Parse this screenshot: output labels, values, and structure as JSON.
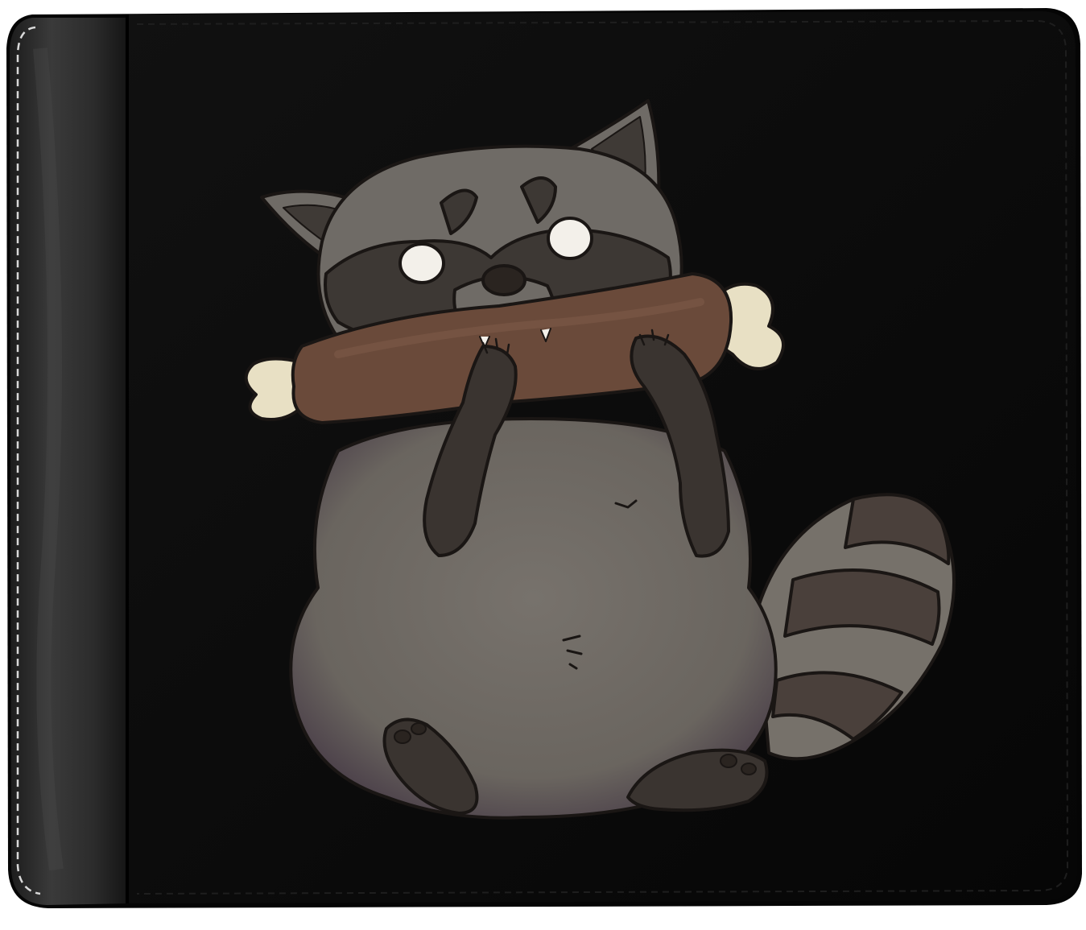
{
  "scene": {
    "subject": "wallet-product-photo",
    "colors": {
      "background": "#ffffff",
      "wallet_front": "#0b0b0b",
      "wallet_spine": "#2a2a2a",
      "stitching": "#d9d9d9",
      "fur_main": "#6f6b66",
      "fur_shadow": "#4a3f48",
      "mask": "#3d3834",
      "drumstick": "#6a4a3a",
      "bone": "#e8e0c4",
      "paws": "#3a3430",
      "tail_dark": "#4a403b",
      "tail_light": "#76716a"
    },
    "icons": {
      "wallet": "bifold-wallet-icon",
      "print": "raccoon-eating-drumstick-illustration"
    }
  }
}
